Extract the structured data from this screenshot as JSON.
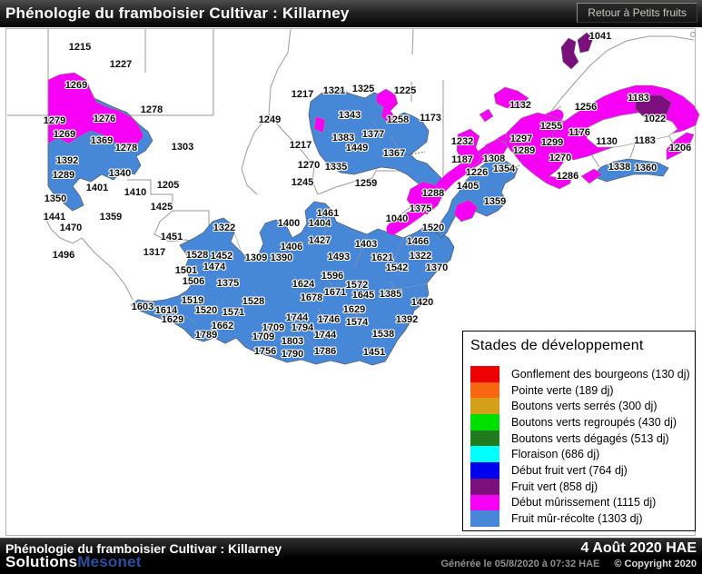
{
  "header": {
    "title": "Phénologie du framboisier Cultivar : Killarney",
    "back_button_label": "Retour à Petits fruits"
  },
  "footer": {
    "title": "Phénologie du framboisier Cultivar : Killarney",
    "date": "4 Août 2020 HAE",
    "generated": "Générée le 05/8/2020 à 07:32 HAE",
    "copyright": "© Copyright 2020",
    "brand_white": "Solutions",
    "brand_blue": "Mesonet"
  },
  "legend": {
    "title": "Stades de développement",
    "items": [
      {
        "label": "Gonflement des bourgeons (130 dj)",
        "color": "#EE0000"
      },
      {
        "label": "Pointe verte (189 dj)",
        "color": "#F96611"
      },
      {
        "label": "Boutons verts serrés (300 dj)",
        "color": "#D4A017"
      },
      {
        "label": "Boutons verts regroupés (430 dj)",
        "color": "#00E000"
      },
      {
        "label": "Boutons verts dégagés (513 dj)",
        "color": "#1E7B1E"
      },
      {
        "label": "Floraison (686 dj)",
        "color": "#00FFFF"
      },
      {
        "label": "Début fruit vert (764 dj)",
        "color": "#0000EE"
      },
      {
        "label": "Fruit vert (858 dj)",
        "color": "#7B0F7B"
      },
      {
        "label": "Début mûrissement (1115 dj)",
        "color": "#F500F5"
      },
      {
        "label": "Fruit mûr-récolte (1303 dj)",
        "color": "#4787D7"
      }
    ]
  },
  "colors": {
    "map_ripe_blue": "#4787D7",
    "map_murissement_magenta": "#F500F5",
    "map_fruit_vert_purple": "#7B0F7B",
    "boundary_gray": "#9A9A9A",
    "brand_blue": "#2B4F9E"
  },
  "map": {
    "units": "degree-days (dj)",
    "labels": [
      [
        "1215",
        88,
        52
      ],
      [
        "1227",
        133,
        71
      ],
      [
        "1269",
        84,
        94
      ],
      [
        "1279",
        60,
        133
      ],
      [
        "1269",
        71,
        148
      ],
      [
        "1276",
        115,
        131
      ],
      [
        "1278",
        167,
        121
      ],
      [
        "1369",
        112,
        155
      ],
      [
        "1278",
        139,
        163
      ],
      [
        "1303",
        201,
        162
      ],
      [
        "1392",
        74,
        177
      ],
      [
        "1289",
        70,
        193
      ],
      [
        "1340",
        132,
        191
      ],
      [
        "1401",
        107,
        207
      ],
      [
        "1410",
        149,
        212
      ],
      [
        "1205",
        185,
        204
      ],
      [
        "1350",
        61,
        219
      ],
      [
        "1425",
        178,
        228
      ],
      [
        "1441",
        60,
        239
      ],
      [
        "1359",
        122,
        239
      ],
      [
        "1470",
        78,
        251
      ],
      [
        "1451",
        189,
        261
      ],
      [
        "1322",
        247,
        251
      ],
      [
        "1496",
        70,
        281
      ],
      [
        "1317",
        170,
        278
      ],
      [
        "1528",
        217,
        281
      ],
      [
        "1452",
        244,
        282
      ],
      [
        "1501",
        205,
        298
      ],
      [
        "1474",
        236,
        294
      ],
      [
        "1506",
        213,
        310
      ],
      [
        "1375",
        251,
        312
      ],
      [
        "1519",
        212,
        331
      ],
      [
        "1603",
        157,
        338
      ],
      [
        "1614",
        183,
        342
      ],
      [
        "1629",
        190,
        352
      ],
      [
        "1520",
        227,
        342
      ],
      [
        "1571",
        257,
        344
      ],
      [
        "1662",
        245,
        359
      ],
      [
        "1789",
        227,
        369
      ],
      [
        "1249",
        297,
        132
      ],
      [
        "1217",
        333,
        104
      ],
      [
        "1321",
        368,
        100
      ],
      [
        "1325",
        400,
        98
      ],
      [
        "1225",
        446,
        100
      ],
      [
        "1343",
        385,
        127
      ],
      [
        "1258",
        438,
        132
      ],
      [
        "1173",
        474,
        130
      ],
      [
        "1383",
        378,
        152
      ],
      [
        "1377",
        411,
        148
      ],
      [
        "1449",
        393,
        163
      ],
      [
        "1367",
        434,
        169
      ],
      [
        "1217",
        331,
        160
      ],
      [
        "1270",
        340,
        182
      ],
      [
        "1335",
        370,
        184
      ],
      [
        "1245",
        333,
        201
      ],
      [
        "1259",
        403,
        202
      ],
      [
        "1288",
        477,
        213
      ],
      [
        "1232",
        509,
        156
      ],
      [
        "1187",
        509,
        176
      ],
      [
        "1308",
        544,
        175
      ],
      [
        "1226",
        525,
        190
      ],
      [
        "1405",
        515,
        205
      ],
      [
        "1354",
        555,
        186
      ],
      [
        "1359",
        545,
        222
      ],
      [
        "1375",
        463,
        230
      ],
      [
        "1040",
        437,
        241
      ],
      [
        "1520",
        477,
        251
      ],
      [
        "1466",
        460,
        266
      ],
      [
        "1322",
        463,
        282
      ],
      [
        "1400",
        318,
        246
      ],
      [
        "1461",
        361,
        235
      ],
      [
        "1404",
        352,
        246
      ],
      [
        "1427",
        352,
        265
      ],
      [
        "1406",
        321,
        272
      ],
      [
        "1403",
        403,
        269
      ],
      [
        "1309",
        282,
        284
      ],
      [
        "1390",
        310,
        284
      ],
      [
        "1493",
        373,
        283
      ],
      [
        "1621",
        421,
        284
      ],
      [
        "1542",
        437,
        295
      ],
      [
        "1370",
        481,
        295
      ],
      [
        "1596",
        366,
        304
      ],
      [
        "1624",
        334,
        313
      ],
      [
        "1572",
        393,
        314
      ],
      [
        "1671",
        369,
        322
      ],
      [
        "1678",
        343,
        328
      ],
      [
        "1645",
        400,
        325
      ],
      [
        "1385",
        430,
        324
      ],
      [
        "1528",
        279,
        332
      ],
      [
        "1629",
        390,
        341
      ],
      [
        "1420",
        465,
        333
      ],
      [
        "1744",
        327,
        350
      ],
      [
        "1746",
        362,
        352
      ],
      [
        "1574",
        393,
        355
      ],
      [
        "1392",
        448,
        352
      ],
      [
        "1709",
        301,
        361
      ],
      [
        "1794",
        333,
        361
      ],
      [
        "1709",
        290,
        371
      ],
      [
        "1803",
        322,
        376
      ],
      [
        "1744",
        358,
        369
      ],
      [
        "1538",
        422,
        368
      ],
      [
        "1756",
        292,
        387
      ],
      [
        "1790",
        322,
        390
      ],
      [
        "1786",
        358,
        387
      ],
      [
        "1451",
        412,
        388
      ],
      [
        "1041",
        661,
        40
      ],
      [
        "1132",
        573,
        116
      ],
      [
        "1256",
        645,
        118
      ],
      [
        "1183",
        703,
        108
      ],
      [
        "1022",
        721,
        131
      ],
      [
        "1255",
        607,
        139
      ],
      [
        "1176",
        638,
        146
      ],
      [
        "1297",
        574,
        153
      ],
      [
        "1299",
        608,
        157
      ],
      [
        "1289",
        577,
        166
      ],
      [
        "1130",
        668,
        156
      ],
      [
        "1183",
        710,
        155
      ],
      [
        "1206",
        749,
        163
      ],
      [
        "1270",
        617,
        174
      ],
      [
        "1286",
        625,
        194
      ],
      [
        "1338",
        682,
        184
      ],
      [
        "1360",
        711,
        185
      ]
    ]
  }
}
